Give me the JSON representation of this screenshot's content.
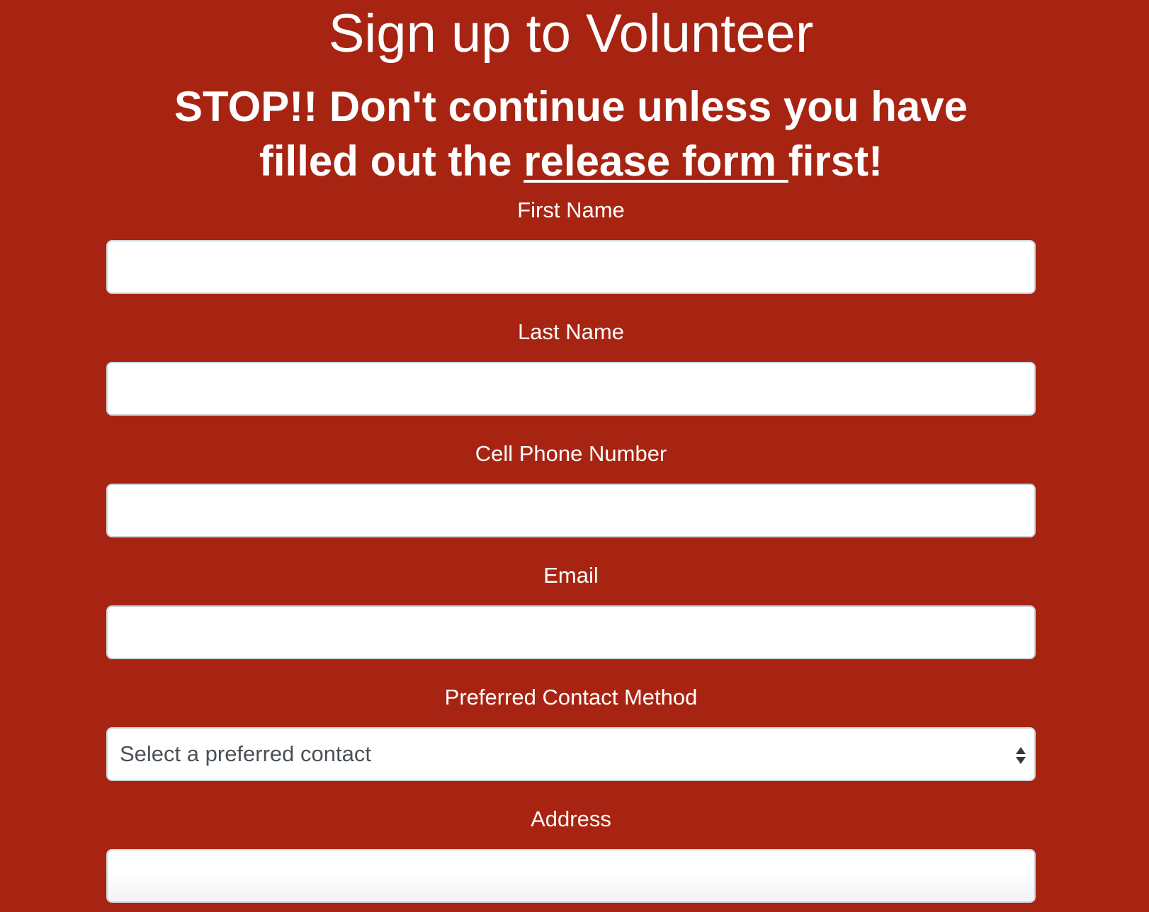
{
  "page": {
    "title": "Sign up to Volunteer",
    "warning_prefix": "STOP!! Don't continue unless you have filled out the ",
    "warning_link": "release form ",
    "warning_suffix": "first!"
  },
  "form": {
    "first_name_label": "First Name",
    "first_name_value": "",
    "last_name_label": "Last Name",
    "last_name_value": "",
    "cell_phone_label": "Cell Phone Number",
    "cell_phone_value": "",
    "email_label": "Email",
    "email_value": "",
    "contact_method_label": "Preferred Contact Method",
    "contact_method_selected": "Select a preferred contact",
    "address_label": "Address",
    "address_value": ""
  },
  "icons": {
    "select_arrows": "sort-arrows-icon"
  },
  "colors": {
    "background": "#a82412",
    "text": "#ffffff",
    "input_background": "#ffffff",
    "input_border": "#ced4da",
    "select_text": "#495057"
  }
}
